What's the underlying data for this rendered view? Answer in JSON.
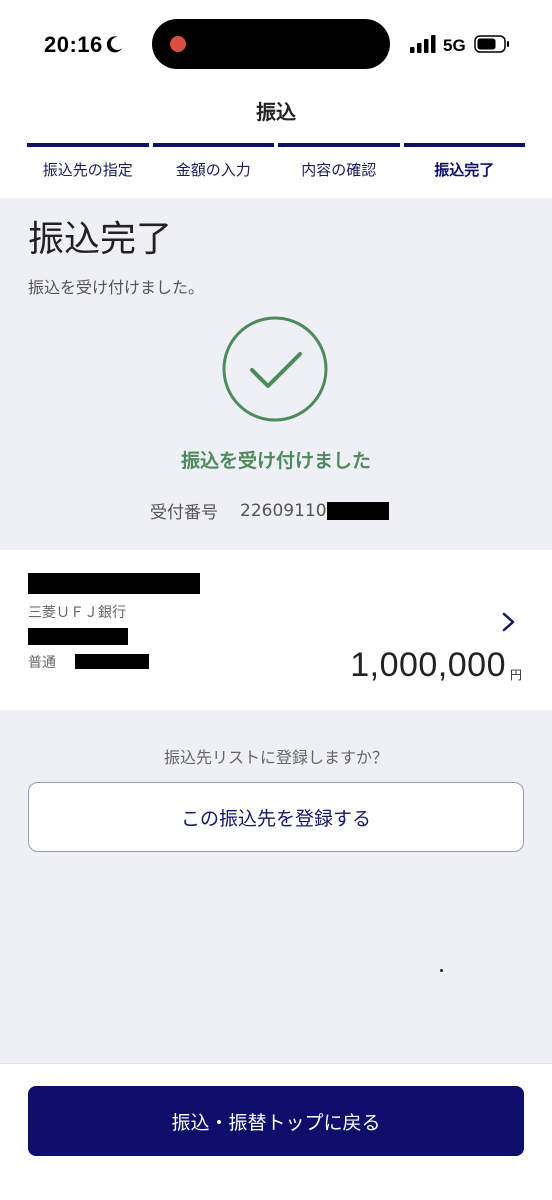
{
  "status_bar": {
    "time": "20:16",
    "network": "5G",
    "icons": [
      "moon-icon",
      "signal-icon",
      "battery-icon"
    ]
  },
  "header": {
    "title": "振込",
    "steps": [
      {
        "label": "振込先の指定",
        "active": false
      },
      {
        "label": "金額の入力",
        "active": false
      },
      {
        "label": "内容の確認",
        "active": false
      },
      {
        "label": "振込完了",
        "active": true
      }
    ]
  },
  "completion": {
    "heading": "振込完了",
    "subtext": "振込を受け付けました。",
    "message": "振込を受け付けました",
    "receipt_label": "受付番号",
    "receipt_number": "22609110"
  },
  "account": {
    "bank_name": "三菱ＵＦＪ銀行",
    "account_type": "普通",
    "amount": "1,000,000",
    "currency": "円"
  },
  "register": {
    "question": "振込先リストに登録しますか？",
    "button_label": "この振込先を登録する"
  },
  "footer": {
    "back_button_label": "振込・振替トップに戻る"
  },
  "colors": {
    "primary": "#0d0f6b",
    "success": "#4d8a5c",
    "background": "#eef0f6"
  }
}
